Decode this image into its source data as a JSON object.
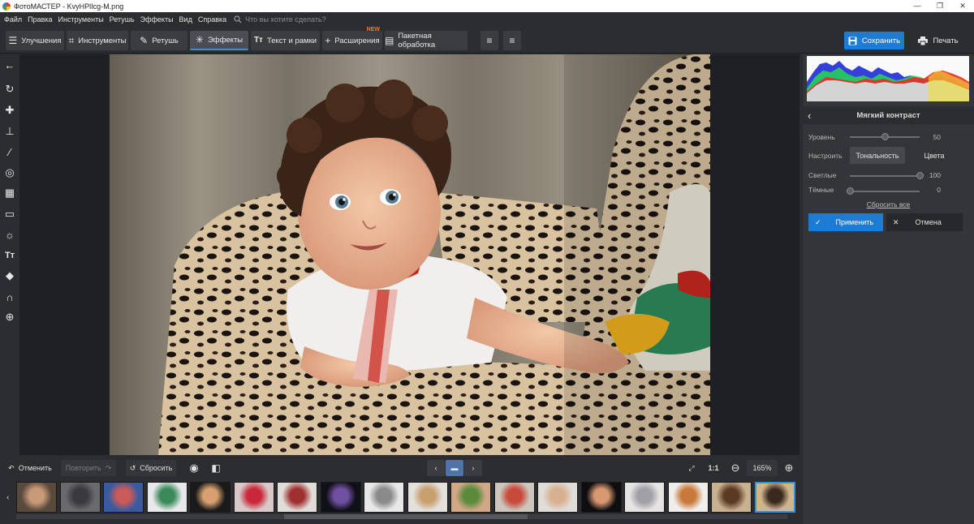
{
  "window": {
    "title": "ФотоМАСТЕР - KvyHPlIcg-M.png",
    "controls": [
      "—",
      "❐",
      "✕"
    ]
  },
  "menu": {
    "items": [
      "Файл",
      "Правка",
      "Инструменты",
      "Ретушь",
      "Эффекты",
      "Вид",
      "Справка"
    ],
    "search_placeholder": "Что вы хотите сделать?"
  },
  "toolbar": {
    "tabs": [
      {
        "label": "Улучшения",
        "icon": "sliders-icon"
      },
      {
        "label": "Инструменты",
        "icon": "crop-icon"
      },
      {
        "label": "Ретушь",
        "icon": "brush-icon"
      },
      {
        "label": "Эффекты",
        "icon": "sparkle-icon"
      },
      {
        "label": "Текст и рамки",
        "icon": "text-icon"
      },
      {
        "label": "Расширения",
        "icon": "plus-icon",
        "badge": "NEW"
      },
      {
        "label": "Пакетная обработка",
        "icon": "batch-icon"
      }
    ],
    "save_label": "Сохранить",
    "print_label": "Печать"
  },
  "left_tools": [
    "back-arrow-icon",
    "rotate-icon",
    "heal-icon",
    "stamp-icon",
    "brush-icon",
    "radial-icon",
    "gradient-icon",
    "vignette-icon",
    "light-icon",
    "text-icon",
    "fill-icon",
    "magnet-icon",
    "globe-icon"
  ],
  "effect_panel": {
    "title": "Мягкий контраст",
    "level_label": "Уровень",
    "level_value": "50",
    "level": 0.5,
    "adjust_label": "Настроить",
    "tab_tonal": "Тональность",
    "tab_colors": "Цвета",
    "lights_label": "Светлые",
    "lights_value": "100",
    "lights": 1.0,
    "darks_label": "Тёмные",
    "darks_value": "0",
    "darks": 0.0,
    "reset_all": "Сбросить все",
    "apply_label": "Применить",
    "cancel_label": "Отмена"
  },
  "bottom": {
    "undo_label": "Отменить",
    "redo_label": "Повторить",
    "reset_label": "Сбросить",
    "ratio_label": "1:1",
    "zoom_value": "165%"
  },
  "colors": {
    "accent": "#1e7bd4",
    "panel": "#333539",
    "bg": "#2b2d30",
    "new_badge": "#ff7a1a"
  },
  "filmstrip": {
    "thumb_count": 18,
    "selected_index": 17
  }
}
